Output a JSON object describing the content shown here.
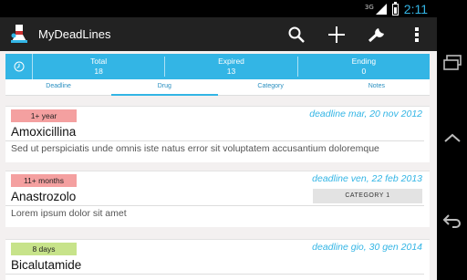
{
  "status_bar": {
    "network_type": "3G",
    "time": "2:11"
  },
  "action_bar": {
    "title": "MyDeadLines",
    "actions": [
      {
        "icon": "search-icon",
        "name": "search-button"
      },
      {
        "icon": "add-icon",
        "name": "add-button"
      },
      {
        "icon": "wrench-icon",
        "name": "settings-button"
      },
      {
        "icon": "overflow-menu-icon",
        "name": "overflow-menu-button"
      }
    ]
  },
  "summary": {
    "total_label": "Total",
    "total_value": "18",
    "expired_label": "Expired",
    "expired_value": "13",
    "ending_label": "Ending",
    "ending_value": "0"
  },
  "tabs": [
    {
      "label": "Deadline",
      "active": false
    },
    {
      "label": "Drug",
      "active": true
    },
    {
      "label": "Category",
      "active": false
    },
    {
      "label": "Notes",
      "active": false
    }
  ],
  "items": [
    {
      "badge": "1+ year",
      "badge_color": "#f4a0a0",
      "deadline": "deadline mar, 20 nov 2012",
      "drug": "Amoxicillina",
      "category": "",
      "notes": "Sed ut perspiciatis unde omnis iste natus error sit voluptatem accusantium doloremque"
    },
    {
      "badge": "11+ months",
      "badge_color": "#f4a0a0",
      "deadline": "deadline ven, 22 feb 2013",
      "drug": "Anastrozolo",
      "category": "CATEGORY 1",
      "notes": "Lorem ipsum dolor sit amet"
    },
    {
      "badge": "8 days",
      "badge_color": "#c7e38a",
      "deadline": "deadline gio, 30 gen 2014",
      "drug": "Bicalutamide",
      "category": "",
      "notes": ""
    }
  ],
  "colors": {
    "accent": "#33b5e5",
    "action_bar": "#222222"
  }
}
